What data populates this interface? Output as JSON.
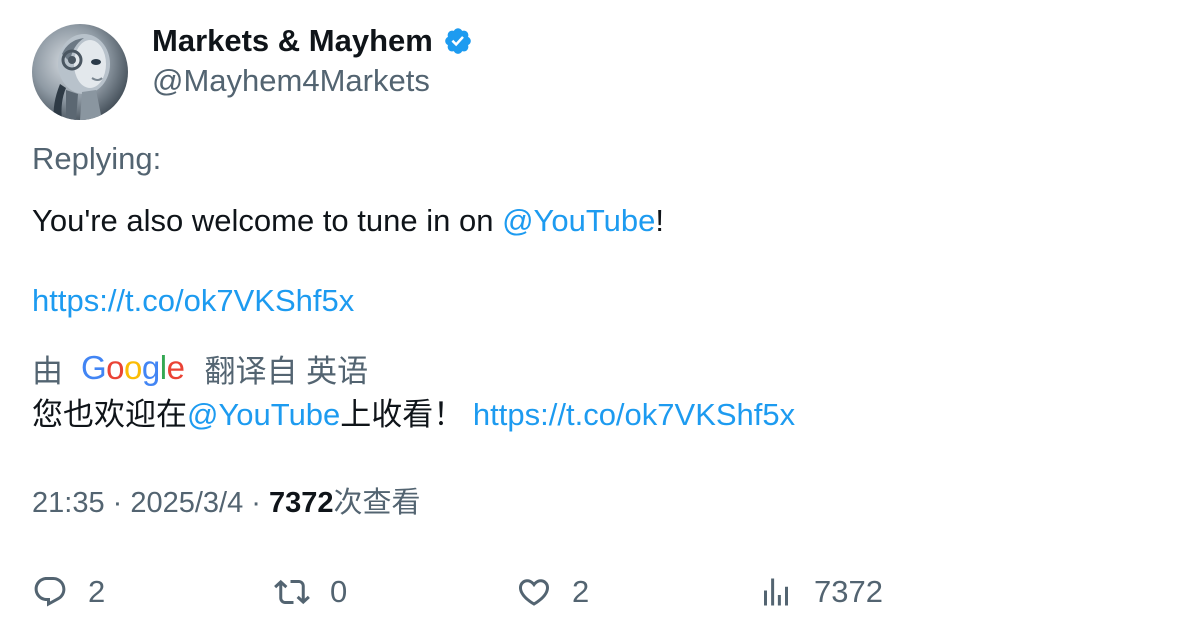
{
  "author": {
    "display_name": "Markets & Mayhem",
    "handle": "@Mayhem4Markets",
    "verified": true,
    "avatar_icon": "robot-avatar"
  },
  "tweet": {
    "replying_label": "Replying:",
    "text_prefix": "You're also welcome to tune in on ",
    "mention": "@YouTube",
    "text_suffix": "!",
    "url": "https://t.co/ok7VKShf5x"
  },
  "translation": {
    "by_label": "由",
    "provider_letters": [
      "G",
      "o",
      "o",
      "g",
      "l",
      "e"
    ],
    "from_label": "翻译自 英语",
    "text_prefix": "您也欢迎在",
    "mention": "@YouTube",
    "text_suffix": "上收看！ ",
    "url": "https://t.co/ok7VKShf5x"
  },
  "meta": {
    "time": "21:35",
    "separator1": " · ",
    "date": "2025/3/4",
    "separator2": " · ",
    "views_count": "7372",
    "views_label": "次查看"
  },
  "actions": {
    "reply_count": "2",
    "retweet_count": "0",
    "like_count": "2",
    "views_count": "7372"
  },
  "colors": {
    "link": "#1d9bf0",
    "secondary_text": "#536471",
    "primary_text": "#0f1419",
    "verified_badge": "#1d9bf0"
  }
}
